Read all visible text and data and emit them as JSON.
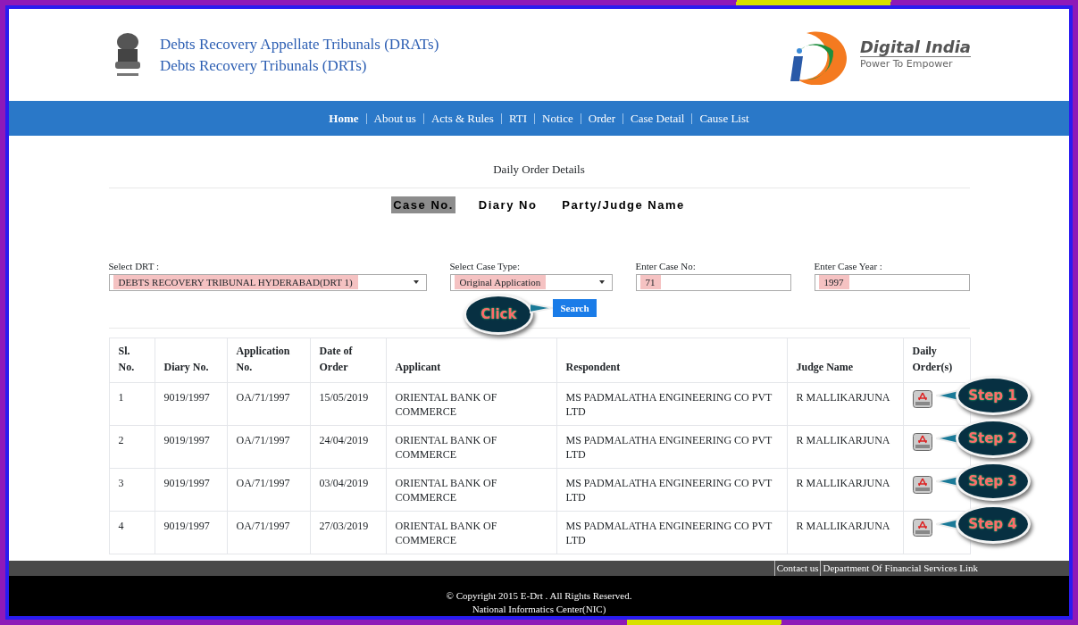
{
  "header": {
    "title_lines": [
      "Debts Recovery Appellate Tribunals (DRATs)",
      "Debts Recovery Tribunals (DRTs)"
    ],
    "logo_title": "Digital India",
    "logo_tagline": "Power To Empower"
  },
  "nav": [
    {
      "label": "Home",
      "selected": true
    },
    {
      "label": "About us",
      "selected": false
    },
    {
      "label": "Acts & Rules",
      "selected": false
    },
    {
      "label": "RTI",
      "selected": false
    },
    {
      "label": "Notice",
      "selected": false
    },
    {
      "label": "Order",
      "selected": false
    },
    {
      "label": "Case Detail",
      "selected": false
    },
    {
      "label": "Cause List",
      "selected": false
    }
  ],
  "page_title": "Daily Order Details",
  "search_tabs": [
    {
      "label": "Case No.",
      "selected": true
    },
    {
      "label": "Diary No",
      "selected": false
    },
    {
      "label": "Party/Judge Name",
      "selected": false
    }
  ],
  "form": [
    {
      "kind": "select",
      "label": "Select DRT :",
      "value": "DEBTS RECOVERY TRIBUNAL HYDERABAD(DRT 1)"
    },
    {
      "kind": "select",
      "label": "Select Case Type:",
      "value": "Original Application"
    },
    {
      "kind": "input",
      "label": "Enter Case No:",
      "value": "71"
    },
    {
      "kind": "input",
      "label": "Enter Case Year :",
      "value": "1997"
    }
  ],
  "search_button": "Search",
  "click_callout": "Click",
  "table": {
    "columns": [
      "Sl. No.",
      "Diary No.",
      "Application No.",
      "Date of Order",
      "Applicant",
      "Respondent",
      "Judge Name",
      "Daily Order(s)"
    ],
    "rows": [
      {
        "cells": [
          "1",
          "9019/1997",
          "OA/71/1997",
          "15/05/2019",
          "ORIENTAL BANK OF COMMERCE",
          "MS PADMALATHA ENGINEERING CO PVT LTD",
          "R MALLIKARJUNA"
        ],
        "callout": "Step 1"
      },
      {
        "cells": [
          "2",
          "9019/1997",
          "OA/71/1997",
          "24/04/2019",
          "ORIENTAL BANK OF COMMERCE",
          "MS PADMALATHA ENGINEERING CO PVT LTD",
          "R MALLIKARJUNA"
        ],
        "callout": "Step 2"
      },
      {
        "cells": [
          "3",
          "9019/1997",
          "OA/71/1997",
          "03/04/2019",
          "ORIENTAL BANK OF COMMERCE",
          "MS PADMALATHA ENGINEERING CO PVT LTD",
          "R MALLIKARJUNA"
        ],
        "callout": "Step 3"
      },
      {
        "cells": [
          "4",
          "9019/1997",
          "OA/71/1997",
          "27/03/2019",
          "ORIENTAL BANK OF COMMERCE",
          "MS PADMALATHA ENGINEERING CO PVT LTD",
          "R MALLIKARJUNA"
        ],
        "callout": "Step 4"
      }
    ]
  },
  "footer_links": [
    "Contact us",
    "Department Of Financial Services Link"
  ],
  "copyright": [
    "© Copyright 2015 E-Drt . All Rights Reserved.",
    "National Informatics Center(NIC)"
  ]
}
